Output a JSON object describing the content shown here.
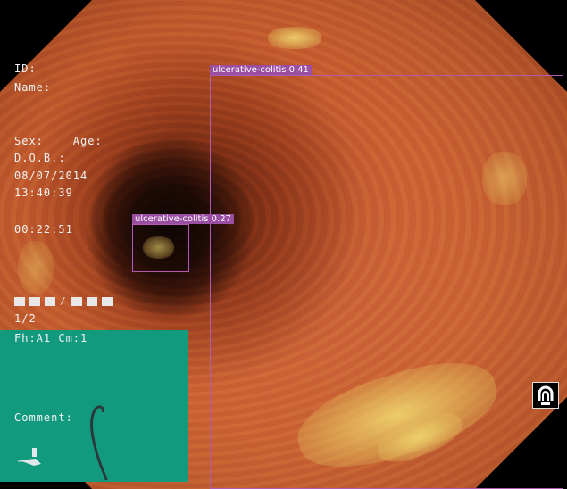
{
  "patient_info": {
    "id_label": "ID:",
    "name_label": "Name:",
    "sex_age": "Sex:    Age:",
    "dob_label": "D.O.B.:",
    "date": "08/07/2014",
    "time": "13:40:39",
    "elapsed": "00:22:51",
    "frame": "1/2",
    "fh_cm": "Fh:A1 Cm:1",
    "comment_label": "Comment:"
  },
  "detections": [
    {
      "label": "ulcerative-colitis",
      "score": "0.41"
    },
    {
      "label": "ulcerative-colitis",
      "score": "0.27"
    }
  ],
  "colors": {
    "bbox": "#b05ab0",
    "bbox_label_bg": "#9a4fa2",
    "info_panel": "#129a7f",
    "text": "#f2f2f2"
  },
  "icons": [
    "magnification-icon",
    "scope-cable-icon",
    "probe-icon"
  ]
}
